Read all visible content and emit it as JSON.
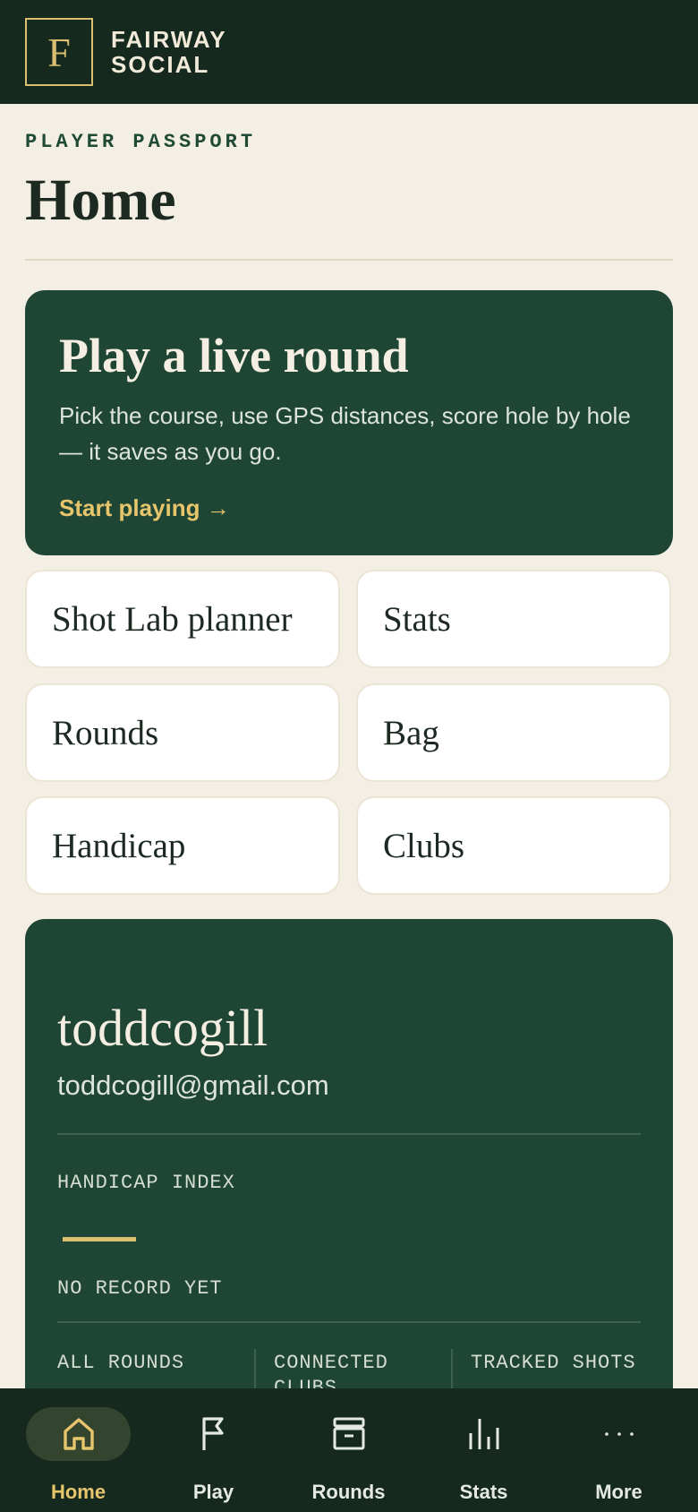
{
  "brand": {
    "logo_letter": "F",
    "line1": "FAIRWAY",
    "line2": "SOCIAL"
  },
  "header": {
    "eyebrow": "PLAYER PASSPORT",
    "title": "Home"
  },
  "hero": {
    "title": "Play a live round",
    "body": "Pick the course, use GPS distances, score hole by hole — it saves as you go.",
    "cta": "Start playing →"
  },
  "tiles": [
    "Shot Lab planner",
    "Stats",
    "Rounds",
    "Bag",
    "Handicap",
    "Clubs"
  ],
  "profile": {
    "username": "toddcogill",
    "email": "toddcogill@gmail.com",
    "handicap_label": "HANDICAP INDEX",
    "handicap_status": "NO RECORD YET",
    "stats": [
      {
        "label": "ALL ROUNDS"
      },
      {
        "label": "CONNECTED CLUBS"
      },
      {
        "label": "TRACKED SHOTS"
      }
    ]
  },
  "nav": {
    "active": "Home",
    "items": [
      {
        "label": "Home",
        "icon": "home-icon"
      },
      {
        "label": "Play",
        "icon": "flag-icon"
      },
      {
        "label": "Rounds",
        "icon": "archive-icon"
      },
      {
        "label": "Stats",
        "icon": "bar-chart-icon"
      },
      {
        "label": "More",
        "icon": "more-dots-icon"
      }
    ]
  },
  "colors": {
    "background": "#f4efe4",
    "dark_green": "#16291f",
    "card_green": "#1f4534",
    "gold": "#e6c56c"
  }
}
